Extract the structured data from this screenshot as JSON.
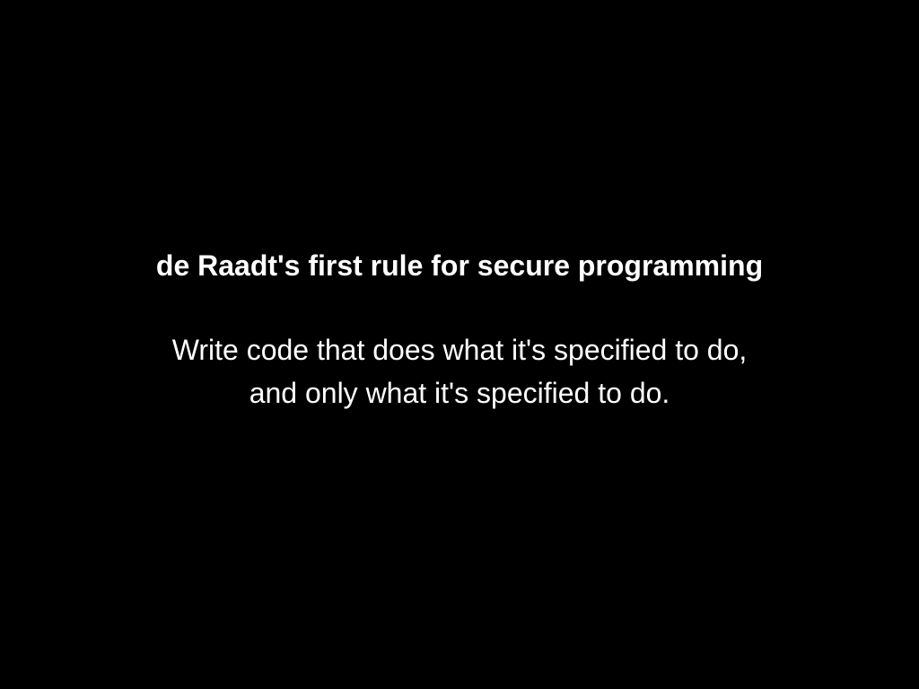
{
  "slide": {
    "title": "de Raadt's first rule for secure programming",
    "body_lines": [
      "Write code that does what it's specified to do,",
      "and only what it's specified to do."
    ]
  },
  "colors": {
    "background": "#000000",
    "text": "#ffffff"
  }
}
